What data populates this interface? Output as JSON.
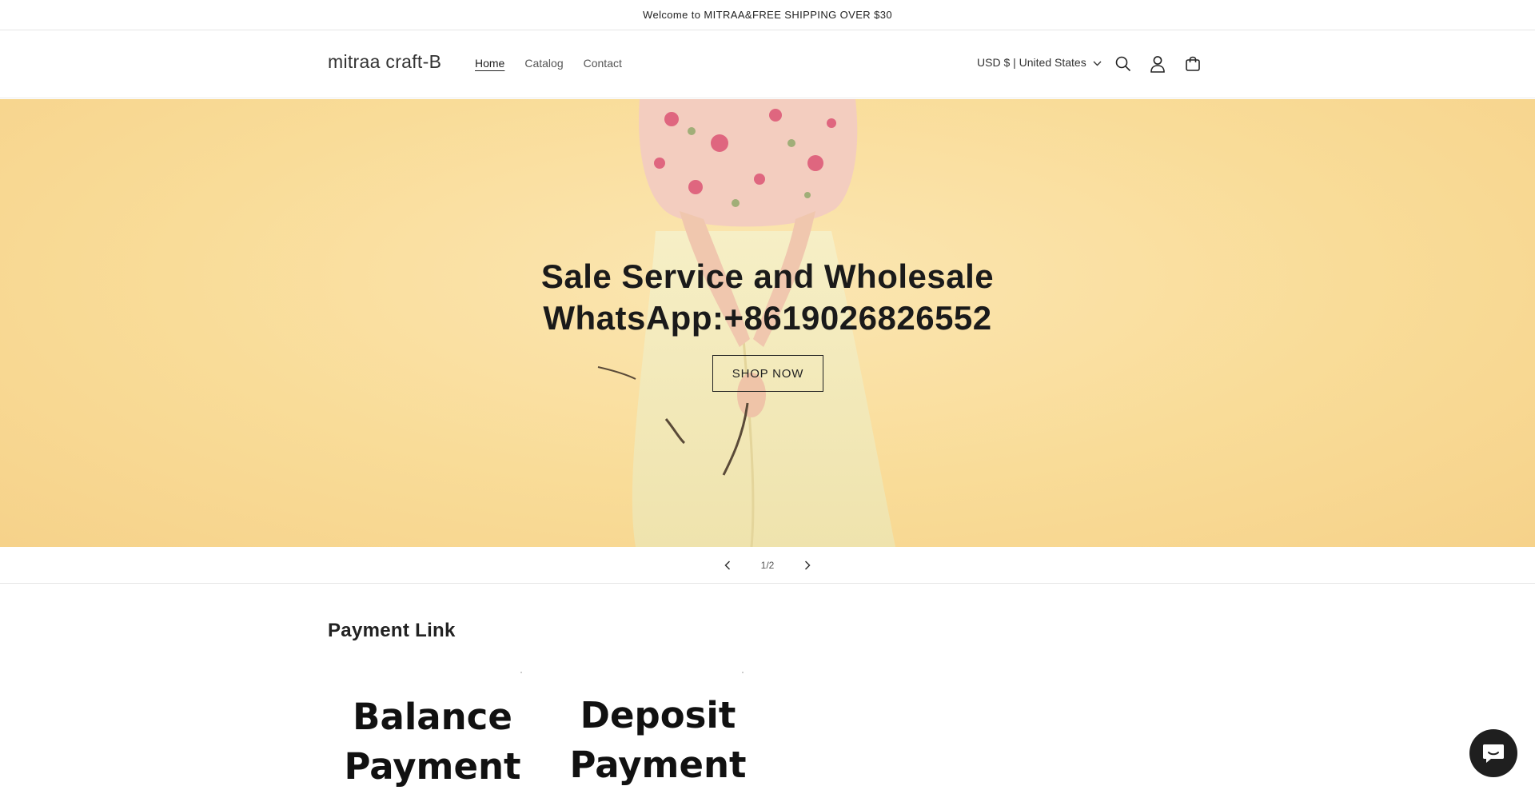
{
  "announcement": {
    "text": "Welcome to MITRAA&FREE SHIPPING OVER $30"
  },
  "header": {
    "logo": "mitraa craft-B",
    "nav": [
      "Home",
      "Catalog",
      "Contact"
    ],
    "currency": "USD $ | United States",
    "icons": [
      "search-icon",
      "account-icon",
      "cart-icon",
      "chevron-down-icon"
    ]
  },
  "hero": {
    "line1": "Sale Service and Wholesale",
    "line2": "WhatsApp:+8619026826552",
    "button": "SHOP NOW",
    "background_color": "#f9dc98"
  },
  "slider": {
    "counter": "1/2"
  },
  "payment": {
    "title": "Payment Link",
    "cards": [
      {
        "line1": "Balance",
        "line2": "Payment"
      },
      {
        "line1": "Deposit",
        "line2": "Payment"
      }
    ]
  },
  "chat": {
    "icon": "chat-icon",
    "color": "#1f1f1f"
  }
}
